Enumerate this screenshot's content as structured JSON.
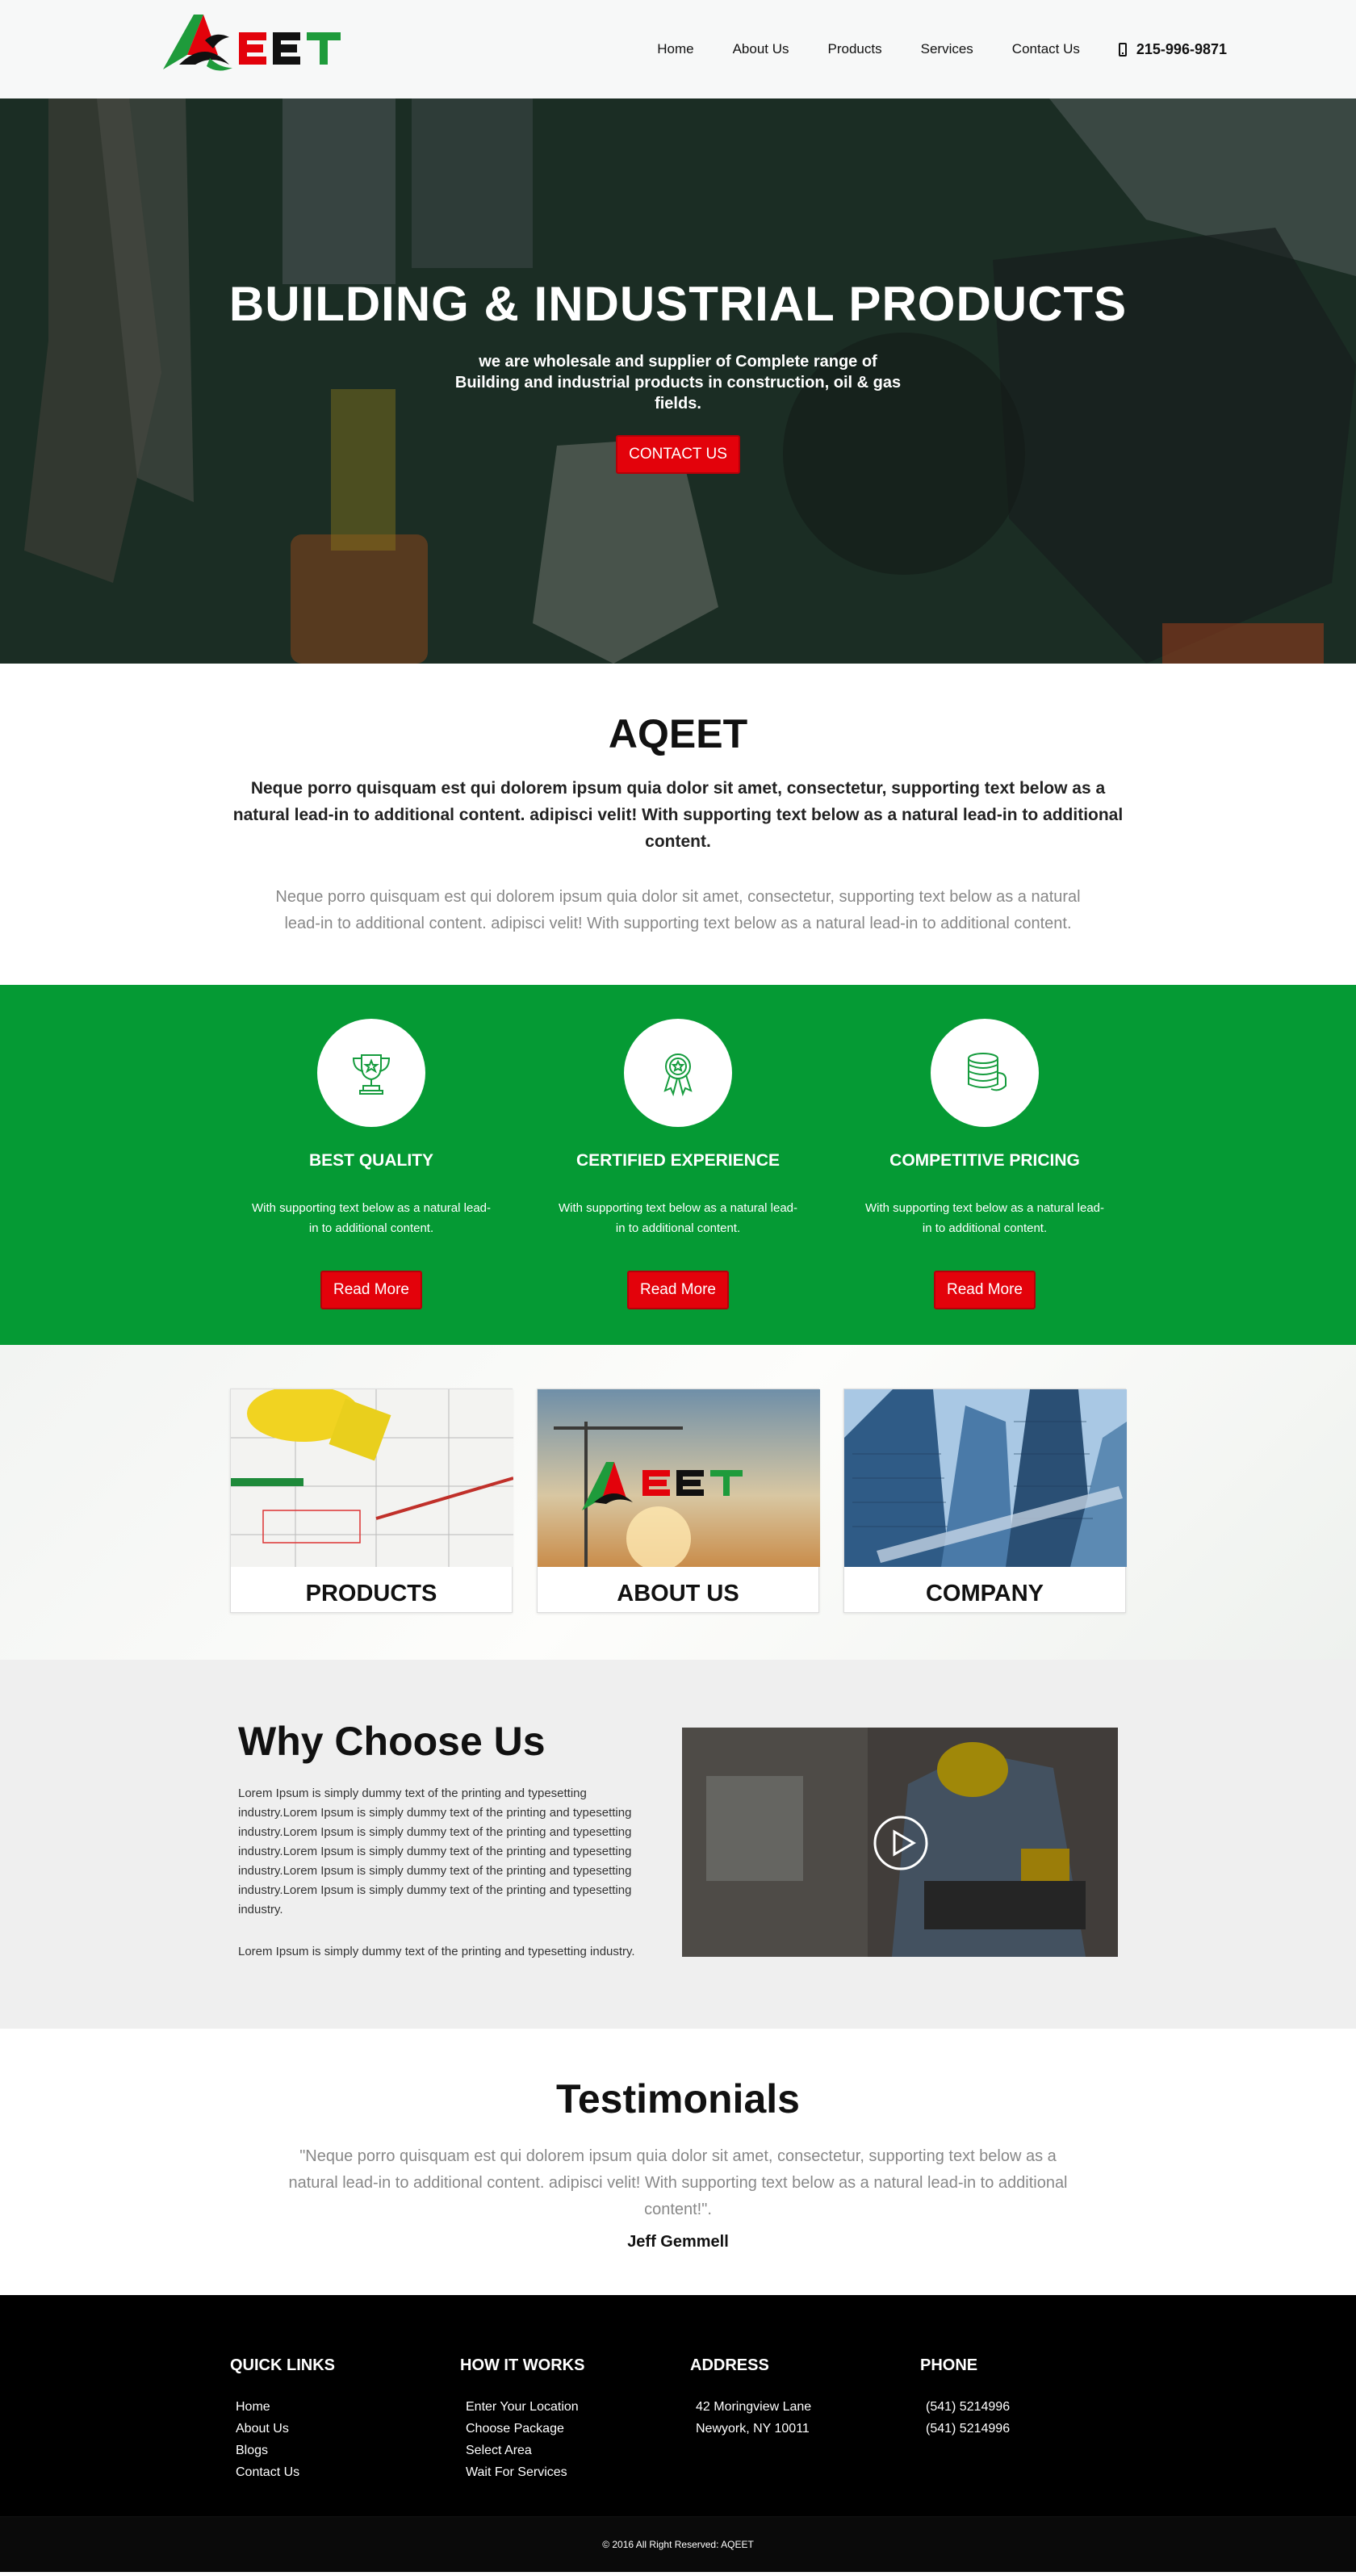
{
  "header": {
    "logo_text": "AQEET",
    "nav": [
      "Home",
      "About Us",
      "Products",
      "Services",
      "Contact Us"
    ],
    "phone": "215-996-9871",
    "phone_icon": "mobile-phone-icon"
  },
  "hero": {
    "title": "BUILDING & INDUSTRIAL PRODUCTS",
    "subtitle": "we are wholesale and supplier of Complete range of Building and industrial products in construction, oil & gas fields.",
    "button": "CONTACT US"
  },
  "about": {
    "title": "AQEET",
    "lead": "Neque porro quisquam est qui dolorem ipsum quia dolor sit amet, consectetur, supporting text below as a natural lead-in to additional content. adipisci velit! With supporting text below as a natural lead-in to additional content.",
    "text": "Neque porro quisquam est qui dolorem ipsum quia dolor sit amet, consectetur, supporting text below as a natural lead-in to additional content. adipisci velit! With supporting text below as a natural lead-in to additional content."
  },
  "features": [
    {
      "icon": "trophy-icon",
      "title": "BEST QUALITY",
      "text": "With supporting text below as a natural lead-in to additional content.",
      "button": "Read More"
    },
    {
      "icon": "award-ribbon-icon",
      "title": "CERTIFIED EXPERIENCE",
      "text": "With supporting text below as a natural lead-in to additional content.",
      "button": "Read More"
    },
    {
      "icon": "coins-stack-icon",
      "title": "COMPETITIVE PRICING",
      "text": "With supporting text below as a natural lead-in to additional content.",
      "button": "Read More"
    }
  ],
  "cards": [
    {
      "title": "PRODUCTS"
    },
    {
      "title": "ABOUT US"
    },
    {
      "title": "COMPANY"
    }
  ],
  "why": {
    "title": "Why Choose Us",
    "p1": "Lorem Ipsum is simply dummy text of the printing and typesetting industry.Lorem Ipsum is simply dummy text of the printing and typesetting industry.Lorem Ipsum is simply dummy text of the printing and typesetting industry.Lorem Ipsum is simply dummy text of the printing and typesetting industry.Lorem Ipsum is simply dummy text of the printing and typesetting industry.Lorem Ipsum is simply dummy text of the printing and typesetting industry.",
    "p2": "Lorem Ipsum is simply dummy text of the printing and typesetting industry."
  },
  "testimonials": {
    "title": "Testimonials",
    "quote": "\"Neque porro quisquam est qui dolorem ipsum quia dolor sit amet, consectetur, supporting text below as a natural lead-in to additional content. adipisci velit! With supporting text below as a natural lead-in to additional content!\".",
    "author": "Jeff Gemmell"
  },
  "footer": {
    "quick_links": {
      "title": "QUICK LINKS",
      "items": [
        "Home",
        "About Us",
        "Blogs",
        "Contact Us"
      ]
    },
    "how_it_works": {
      "title": "HOW IT WORKS",
      "items": [
        "Enter Your Location",
        "Choose Package",
        "Select Area",
        "Wait For Services"
      ]
    },
    "address": {
      "title": "ADDRESS",
      "items": [
        "42 Moringview Lane",
        "Newyork, NY 10011"
      ]
    },
    "phone": {
      "title": "PHONE",
      "items": [
        "(541) 5214996",
        "(541) 5214996"
      ]
    },
    "copyright": "© 2016 All Right Reserved: AQEET"
  },
  "colors": {
    "brand_green": "#059a34",
    "brand_red": "#e3020b",
    "footer_bg": "#000000"
  }
}
